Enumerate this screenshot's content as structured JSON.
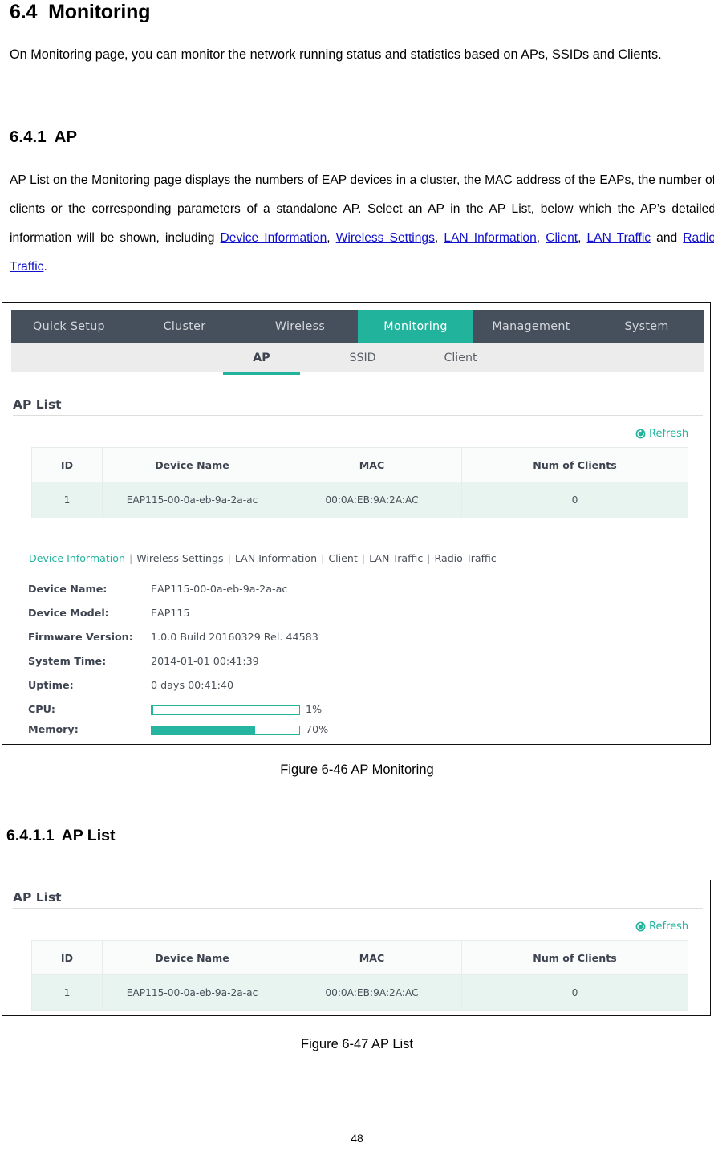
{
  "document": {
    "heading_64": {
      "num": "6.4",
      "text": "Monitoring"
    },
    "intro_paragraph": "On Monitoring page, you can monitor the network running status and statistics based on APs, SSIDs and Clients.",
    "heading_641": {
      "num": "6.4.1",
      "text": "AP"
    },
    "ap_paragraph": {
      "part1": "AP List on the Monitoring page displays the numbers of EAP devices in a cluster, the MAC address of the EAPs, the number of clients or the corresponding parameters of a standalone AP. Select an AP in the AP List, below which the AP’s detailed information will be shown, including ",
      "link1": "Device Information",
      "sep1": ", ",
      "link2": "Wireless Settings",
      "sep2": ", ",
      "link3": "LAN Information",
      "sep3": ", ",
      "link4": "Client",
      "sep4": ", ",
      "link5": "LAN Traffic",
      "sep5": " and ",
      "link6": "Radio Traffic",
      "end": "."
    },
    "figure_caption_1": "Figure 6-46 AP Monitoring",
    "heading_6411": {
      "num": "6.4.1.1",
      "text": "AP List"
    },
    "figure_caption_2": "Figure 6-47 AP List",
    "page_number": "48"
  },
  "screenshot": {
    "nav_tabs": [
      {
        "label": "Quick Setup",
        "active": false
      },
      {
        "label": "Cluster",
        "active": false
      },
      {
        "label": "Wireless",
        "active": false
      },
      {
        "label": "Monitoring",
        "active": true
      },
      {
        "label": "Management",
        "active": false
      },
      {
        "label": "System",
        "active": false
      }
    ],
    "sub_tabs": [
      {
        "label": "AP",
        "active": true
      },
      {
        "label": "SSID",
        "active": false
      },
      {
        "label": "Client",
        "active": false
      }
    ],
    "section_title": "AP List",
    "refresh_label": "Refresh",
    "refresh_icon": "refresh-icon",
    "table": {
      "columns": [
        "ID",
        "Device Name",
        "MAC",
        "Num of Clients"
      ],
      "rows": [
        [
          "1",
          "EAP115-00-0a-eb-9a-2a-ac",
          "00:0A:EB:9A:2A:AC",
          "0"
        ]
      ]
    },
    "detail_tabs": [
      {
        "label": "Device Information",
        "active": true
      },
      {
        "label": "Wireless Settings",
        "active": false
      },
      {
        "label": "LAN Information",
        "active": false
      },
      {
        "label": "Client",
        "active": false
      },
      {
        "label": "LAN Traffic",
        "active": false
      },
      {
        "label": "Radio Traffic",
        "active": false
      }
    ],
    "detail_tab_separator": "|",
    "device_information": [
      {
        "label": "Device Name:",
        "value": "EAP115-00-0a-eb-9a-2a-ac"
      },
      {
        "label": "Device Model:",
        "value": "EAP115"
      },
      {
        "label": "Firmware Version:",
        "value": "1.0.0 Build 20160329 Rel. 44583"
      },
      {
        "label": "System Time:",
        "value": "2014-01-01 00:41:39"
      },
      {
        "label": "Uptime:",
        "value": "0 days 00:41:40"
      }
    ],
    "meters": [
      {
        "label": "CPU:",
        "percent_text": "1%",
        "percent": 1
      },
      {
        "label": "Memory:",
        "percent_text": "70%",
        "percent": 70
      }
    ],
    "colors": {
      "accent": "#22b39c",
      "nav_background": "#464f5c",
      "subnav_background": "#ececec",
      "row_background": "#e7f4f0",
      "link": "#1111cc"
    }
  }
}
